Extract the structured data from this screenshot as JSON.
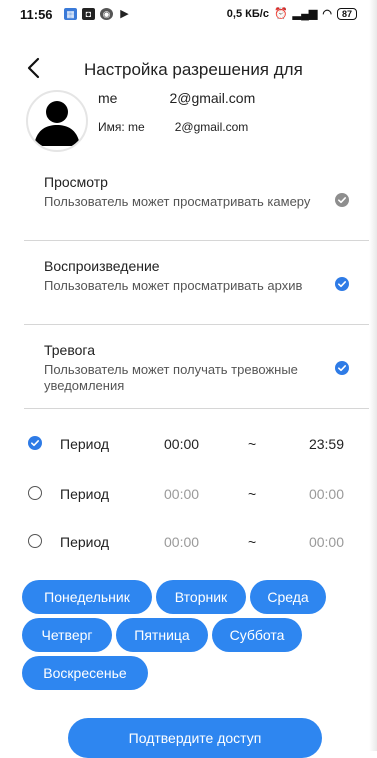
{
  "status_bar": {
    "time": "11:56",
    "network_speed": "0,5 КБ/с",
    "battery": "87"
  },
  "header": {
    "title": "Настройка разрешения для"
  },
  "user": {
    "name_label": "me",
    "email_partial": "2@gmail.com",
    "name_prefix": "Имя: me",
    "name_suffix": "2@gmail.com"
  },
  "permissions": [
    {
      "title": "Просмотр",
      "description": "Пользователь может просматривать камеру",
      "checked": true,
      "color": "#8e8e8e"
    },
    {
      "title": "Воспроизведение",
      "description": "Пользователь может просматривать архив",
      "checked": true,
      "color": "#2e7be6"
    },
    {
      "title": "Тревога",
      "description": "Пользователь может получать тревожные уведомления",
      "checked": true,
      "color": "#2e7be6"
    }
  ],
  "periods": [
    {
      "label": "Период",
      "start": "00:00",
      "separator": "~",
      "end": "23:59",
      "selected": true
    },
    {
      "label": "Период",
      "start": "00:00",
      "separator": "~",
      "end": "00:00",
      "selected": false
    },
    {
      "label": "Период",
      "start": "00:00",
      "separator": "~",
      "end": "00:00",
      "selected": false
    }
  ],
  "days": [
    "Понедельник",
    "Вторник",
    "Среда",
    "Четверг",
    "Пятница",
    "Суббота",
    "Воскресенье"
  ],
  "confirm_label": "Подтвердите доступ",
  "colors": {
    "accent": "#2e86f0",
    "check_grey": "#8e8e8e"
  }
}
